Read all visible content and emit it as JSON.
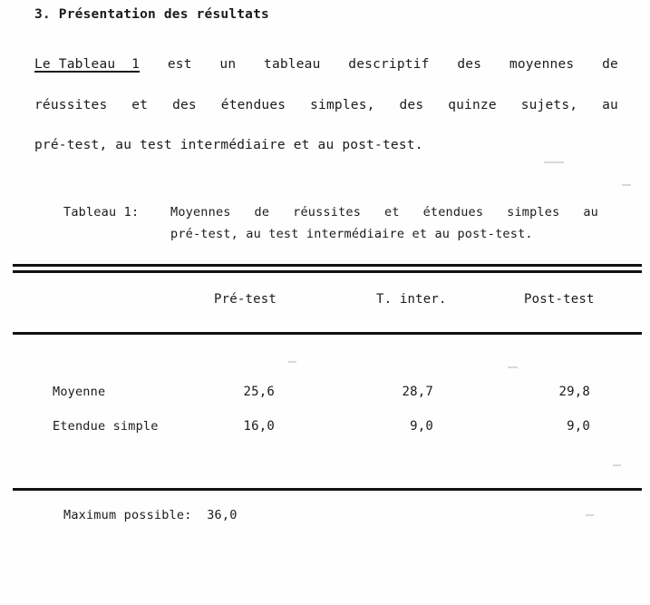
{
  "document": {
    "section_heading": "3. Présentation des résultats",
    "paragraph": {
      "line_1": {
        "ref": "Le Tableau  1",
        "words": [
          "est",
          "un",
          "tableau",
          "descriptif",
          "des",
          "moyennes",
          "de"
        ]
      },
      "line_2": {
        "words": [
          "réussites",
          "et",
          "des",
          "étendues",
          "simples,",
          "des",
          "quinze",
          "sujets,",
          "au"
        ]
      },
      "line_3": "pré-test, au test intermédiaire et au post-test."
    }
  },
  "table": {
    "caption": {
      "label": "Tableau 1:",
      "line_1_words": [
        "Moyennes",
        "de",
        "réussites",
        "et",
        "étendues",
        "simples",
        "au"
      ],
      "line_2": "pré-test, au test intermédiaire et au post-test."
    },
    "column_headers": [
      "Pré-test",
      "T. inter.",
      "Post-test"
    ],
    "rows": [
      {
        "label": "Moyenne",
        "values": [
          "25,6",
          "28,7",
          "29,8"
        ]
      },
      {
        "label": "Etendue simple",
        "values": [
          "16,0",
          "9,0",
          "9,0"
        ]
      }
    ],
    "footnote": "Maximum possible:  36,0"
  },
  "chart_data": {
    "type": "table",
    "title": "Tableau 1: Moyennes de réussites et étendues simples au pré-test, au test intermédiaire et au post-test.",
    "categories": [
      "Pré-test",
      "T. inter.",
      "Post-test"
    ],
    "series": [
      {
        "name": "Moyenne",
        "values": [
          25.6,
          28.7,
          29.8
        ]
      },
      {
        "name": "Etendue simple",
        "values": [
          16.0,
          9.0,
          9.0
        ]
      }
    ],
    "notes": "Maximum possible: 36,0",
    "max_possible": 36.0,
    "n_subjects": 15
  }
}
